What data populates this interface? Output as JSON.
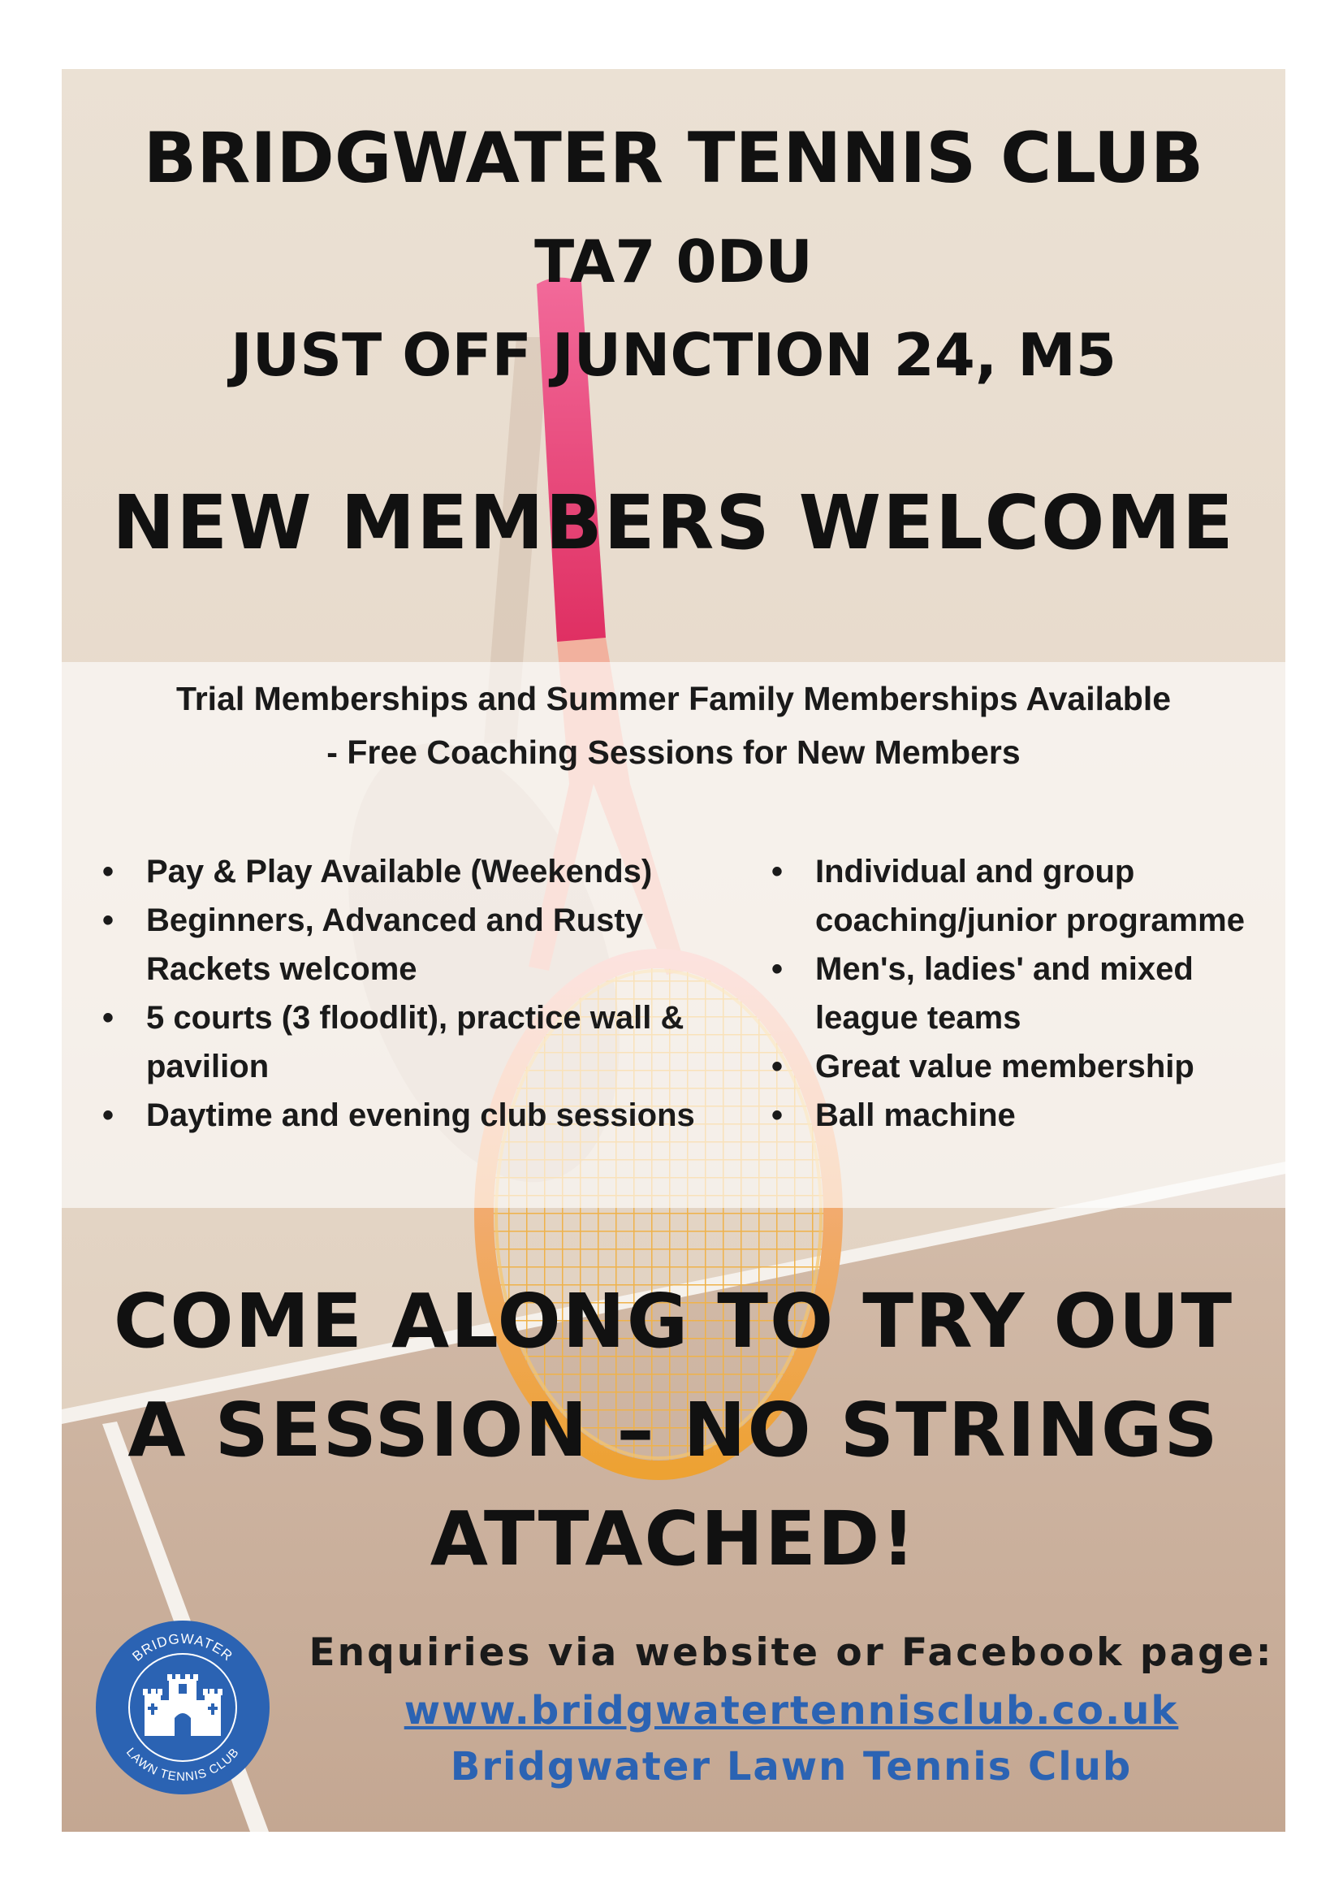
{
  "header": {
    "club_name": "BRIDGWATER TENNIS CLUB",
    "postcode": "TA7 0DU",
    "location": "JUST OFF JUNCTION 24, M5",
    "headline": "NEW MEMBERS WELCOME"
  },
  "offer": {
    "line1": "Trial Memberships and Summer Family Memberships Available",
    "line2": "- Free Coaching Sessions for New Members"
  },
  "features": {
    "bullet": "•",
    "left": [
      "Pay & Play Available (Weekends)",
      "Beginners, Advanced and Rusty Rackets welcome",
      "5 courts (3 floodlit), practice wall & pavilion",
      "Daytime and evening club sessions"
    ],
    "right": [
      "Individual and group coaching/junior programme",
      "Men's, ladies' and mixed league teams",
      "Great value membership",
      "Ball machine"
    ]
  },
  "cta": {
    "line1": "COME ALONG TO TRY OUT",
    "line2": "A SESSION – NO STRINGS",
    "line3": "ATTACHED!"
  },
  "contact": {
    "enquiries": "Enquiries via website or Facebook page:",
    "website": "www.bridgwatertennisclub.co.uk",
    "facebook": "Bridgwater Lawn Tennis Club"
  },
  "logo": {
    "top_text": "BRIDGWATER",
    "bottom_text": "LAWN TENNIS CLUB",
    "color": "#2b63b3"
  },
  "colors": {
    "text": "#111111",
    "link": "#2b63b3",
    "racket_grip": "#e8407a",
    "racket_frame": "#f0a53a",
    "court": "#c7ab95"
  }
}
